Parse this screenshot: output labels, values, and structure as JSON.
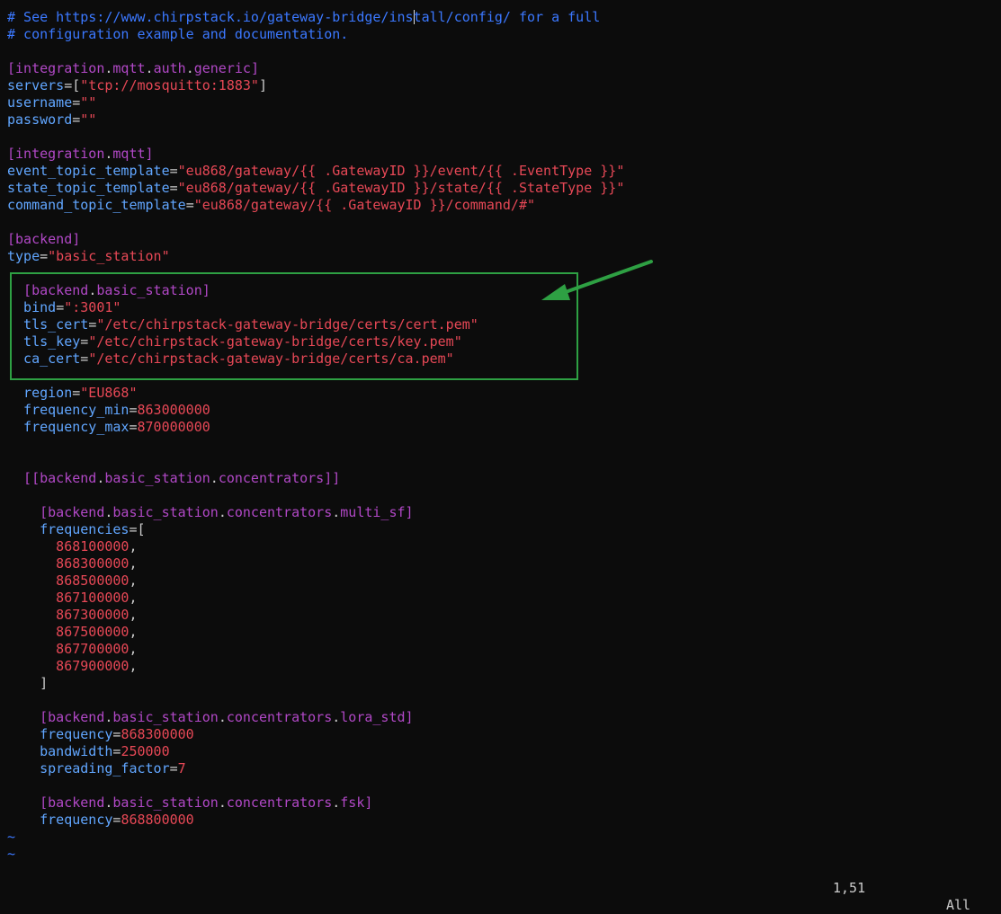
{
  "editor": {
    "lines": [
      [
        {
          "t": "# See https://www.chirpstack.io/gateway-bridge/ins",
          "c": "comment"
        },
        {
          "cursor": true
        },
        {
          "t": "tall/config/ for a full",
          "c": "comment"
        }
      ],
      [
        {
          "t": "# configuration example and documentation.",
          "c": "comment"
        }
      ],
      [],
      [
        {
          "t": "[",
          "c": "tbl"
        },
        {
          "t": "integration",
          "c": "tbl"
        },
        {
          "t": ".",
          "c": "punc"
        },
        {
          "t": "mqtt",
          "c": "tbl"
        },
        {
          "t": ".",
          "c": "punc"
        },
        {
          "t": "auth",
          "c": "tbl"
        },
        {
          "t": ".",
          "c": "punc"
        },
        {
          "t": "generic",
          "c": "tbl"
        },
        {
          "t": "]",
          "c": "tbl"
        }
      ],
      [
        {
          "t": "servers",
          "c": "key"
        },
        {
          "t": "=[",
          "c": "eq"
        },
        {
          "t": "\"tcp://mosquitto:1883\"",
          "c": "str"
        },
        {
          "t": "]",
          "c": "punc"
        }
      ],
      [
        {
          "t": "username",
          "c": "key"
        },
        {
          "t": "=",
          "c": "eq"
        },
        {
          "t": "\"\"",
          "c": "str"
        }
      ],
      [
        {
          "t": "password",
          "c": "key"
        },
        {
          "t": "=",
          "c": "eq"
        },
        {
          "t": "\"\"",
          "c": "str"
        }
      ],
      [],
      [
        {
          "t": "[",
          "c": "tbl"
        },
        {
          "t": "integration",
          "c": "tbl"
        },
        {
          "t": ".",
          "c": "punc"
        },
        {
          "t": "mqtt",
          "c": "tbl"
        },
        {
          "t": "]",
          "c": "tbl"
        }
      ],
      [
        {
          "t": "event_topic_template",
          "c": "key"
        },
        {
          "t": "=",
          "c": "eq"
        },
        {
          "t": "\"eu868/gateway/{{ .GatewayID }}/event/{{ .EventType }}\"",
          "c": "str"
        }
      ],
      [
        {
          "t": "state_topic_template",
          "c": "key"
        },
        {
          "t": "=",
          "c": "eq"
        },
        {
          "t": "\"eu868/gateway/{{ .GatewayID }}/state/{{ .StateType }}\"",
          "c": "str"
        }
      ],
      [
        {
          "t": "command_topic_template",
          "c": "key"
        },
        {
          "t": "=",
          "c": "eq"
        },
        {
          "t": "\"eu868/gateway/{{ .GatewayID }}/command/#\"",
          "c": "str"
        }
      ],
      [],
      [
        {
          "t": "[",
          "c": "tbl"
        },
        {
          "t": "backend",
          "c": "tbl"
        },
        {
          "t": "]",
          "c": "tbl"
        }
      ],
      [
        {
          "t": "type",
          "c": "key"
        },
        {
          "t": "=",
          "c": "eq"
        },
        {
          "t": "\"basic_station\"",
          "c": "str"
        }
      ],
      [],
      [
        {
          "t": "  [",
          "c": "tbl"
        },
        {
          "t": "backend",
          "c": "tbl"
        },
        {
          "t": ".",
          "c": "punc"
        },
        {
          "t": "basic_station",
          "c": "tbl"
        },
        {
          "t": "]",
          "c": "tbl"
        }
      ],
      [
        {
          "t": "  bind",
          "c": "key"
        },
        {
          "t": "=",
          "c": "eq"
        },
        {
          "t": "\":3001\"",
          "c": "str"
        }
      ],
      [
        {
          "t": "  tls_cert",
          "c": "key"
        },
        {
          "t": "=",
          "c": "eq"
        },
        {
          "t": "\"/etc/chirpstack-gateway-bridge/certs/cert.pem\"",
          "c": "str"
        }
      ],
      [
        {
          "t": "  tls_key",
          "c": "key"
        },
        {
          "t": "=",
          "c": "eq"
        },
        {
          "t": "\"/etc/chirpstack-gateway-bridge/certs/key.pem\"",
          "c": "str"
        }
      ],
      [
        {
          "t": "  ca_cert",
          "c": "key"
        },
        {
          "t": "=",
          "c": "eq"
        },
        {
          "t": "\"/etc/chirpstack-gateway-bridge/certs/ca.pem\"",
          "c": "str"
        }
      ],
      [],
      [
        {
          "t": "  region",
          "c": "key"
        },
        {
          "t": "=",
          "c": "eq"
        },
        {
          "t": "\"EU868\"",
          "c": "str"
        }
      ],
      [
        {
          "t": "  frequency_min",
          "c": "key"
        },
        {
          "t": "=",
          "c": "eq"
        },
        {
          "t": "863000000",
          "c": "num"
        }
      ],
      [
        {
          "t": "  frequency_max",
          "c": "key"
        },
        {
          "t": "=",
          "c": "eq"
        },
        {
          "t": "870000000",
          "c": "num"
        }
      ],
      [],
      [],
      [
        {
          "t": "  [[",
          "c": "tbl"
        },
        {
          "t": "backend",
          "c": "tbl"
        },
        {
          "t": ".",
          "c": "punc"
        },
        {
          "t": "basic_station",
          "c": "tbl"
        },
        {
          "t": ".",
          "c": "punc"
        },
        {
          "t": "concentrators",
          "c": "tbl"
        },
        {
          "t": "]]",
          "c": "tbl"
        }
      ],
      [],
      [
        {
          "t": "    [",
          "c": "tbl"
        },
        {
          "t": "backend",
          "c": "tbl"
        },
        {
          "t": ".",
          "c": "punc"
        },
        {
          "t": "basic_station",
          "c": "tbl"
        },
        {
          "t": ".",
          "c": "punc"
        },
        {
          "t": "concentrators",
          "c": "tbl"
        },
        {
          "t": ".",
          "c": "punc"
        },
        {
          "t": "multi_sf",
          "c": "tbl"
        },
        {
          "t": "]",
          "c": "tbl"
        }
      ],
      [
        {
          "t": "    frequencies",
          "c": "key"
        },
        {
          "t": "=[",
          "c": "eq"
        }
      ],
      [
        {
          "t": "      868100000",
          "c": "num"
        },
        {
          "t": ",",
          "c": "punc"
        }
      ],
      [
        {
          "t": "      868300000",
          "c": "num"
        },
        {
          "t": ",",
          "c": "punc"
        }
      ],
      [
        {
          "t": "      868500000",
          "c": "num"
        },
        {
          "t": ",",
          "c": "punc"
        }
      ],
      [
        {
          "t": "      867100000",
          "c": "num"
        },
        {
          "t": ",",
          "c": "punc"
        }
      ],
      [
        {
          "t": "      867300000",
          "c": "num"
        },
        {
          "t": ",",
          "c": "punc"
        }
      ],
      [
        {
          "t": "      867500000",
          "c": "num"
        },
        {
          "t": ",",
          "c": "punc"
        }
      ],
      [
        {
          "t": "      867700000",
          "c": "num"
        },
        {
          "t": ",",
          "c": "punc"
        }
      ],
      [
        {
          "t": "      867900000",
          "c": "num"
        },
        {
          "t": ",",
          "c": "punc"
        }
      ],
      [
        {
          "t": "    ]",
          "c": "punc"
        }
      ],
      [],
      [
        {
          "t": "    [",
          "c": "tbl"
        },
        {
          "t": "backend",
          "c": "tbl"
        },
        {
          "t": ".",
          "c": "punc"
        },
        {
          "t": "basic_station",
          "c": "tbl"
        },
        {
          "t": ".",
          "c": "punc"
        },
        {
          "t": "concentrators",
          "c": "tbl"
        },
        {
          "t": ".",
          "c": "punc"
        },
        {
          "t": "lora_std",
          "c": "tbl"
        },
        {
          "t": "]",
          "c": "tbl"
        }
      ],
      [
        {
          "t": "    frequency",
          "c": "key"
        },
        {
          "t": "=",
          "c": "eq"
        },
        {
          "t": "868300000",
          "c": "num"
        }
      ],
      [
        {
          "t": "    bandwidth",
          "c": "key"
        },
        {
          "t": "=",
          "c": "eq"
        },
        {
          "t": "250000",
          "c": "num"
        }
      ],
      [
        {
          "t": "    spreading_factor",
          "c": "key"
        },
        {
          "t": "=",
          "c": "eq"
        },
        {
          "t": "7",
          "c": "num"
        }
      ],
      [],
      [
        {
          "t": "    [",
          "c": "tbl"
        },
        {
          "t": "backend",
          "c": "tbl"
        },
        {
          "t": ".",
          "c": "punc"
        },
        {
          "t": "basic_station",
          "c": "tbl"
        },
        {
          "t": ".",
          "c": "punc"
        },
        {
          "t": "concentrators",
          "c": "tbl"
        },
        {
          "t": ".",
          "c": "punc"
        },
        {
          "t": "fsk",
          "c": "tbl"
        },
        {
          "t": "]",
          "c": "tbl"
        }
      ],
      [
        {
          "t": "    frequency",
          "c": "key"
        },
        {
          "t": "=",
          "c": "eq"
        },
        {
          "t": "868800000",
          "c": "num"
        }
      ],
      [
        {
          "t": "~",
          "c": "tilde"
        }
      ],
      [
        {
          "t": "~",
          "c": "tilde"
        }
      ]
    ]
  },
  "statusbar": {
    "cursor_position": "1,51",
    "scroll_position": "All"
  },
  "colors": {
    "background": "#0c0c0c",
    "comment": "#3b78ff",
    "table_header": "#b148c6",
    "key": "#61a6ff",
    "string_value": "#e74856",
    "annotation_green": "#2ea043"
  },
  "annotation": {
    "highlight_box": "green-rectangle",
    "arrow": "green-arrow-pointing-left"
  }
}
